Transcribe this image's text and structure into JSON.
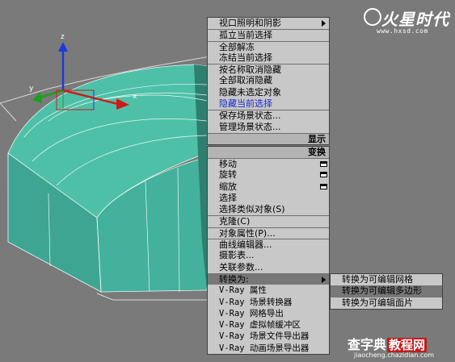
{
  "logo": {
    "main": "火星时代",
    "url": "www.hxsd.com"
  },
  "viewport": {
    "axis_labels": {
      "x": "x",
      "y": "y",
      "z": "z"
    }
  },
  "quad_menu_top": {
    "items": [
      {
        "label": "视口照明和阴影",
        "submenu": true
      },
      {
        "label": "孤立当前选择"
      },
      {
        "label": "全部解冻"
      },
      {
        "label": "冻结当前选择"
      },
      {
        "label": "按名称取消隐藏"
      },
      {
        "label": "全部取消隐藏"
      },
      {
        "label": "隐藏未选定对象"
      },
      {
        "label": "隐藏当前选择",
        "highlight": true
      },
      {
        "label": "保存场景状态..."
      },
      {
        "label": "管理场景状态..."
      }
    ],
    "quad_label": "显示"
  },
  "quad_menu_bottom": {
    "quad_label": "变换",
    "items": [
      {
        "label": "移动",
        "options_box": true
      },
      {
        "label": "旋转",
        "options_box": true
      },
      {
        "label": "缩放",
        "options_box": true
      },
      {
        "label": "选择"
      },
      {
        "label": "选择类似对象(S)"
      },
      {
        "label": "克隆(C)"
      },
      {
        "label": "对象属性(P)..."
      },
      {
        "label": "曲线编辑器..."
      },
      {
        "label": "摄影表..."
      },
      {
        "label": "关联参数..."
      },
      {
        "label": "转换为:",
        "submenu": true,
        "active": true
      },
      {
        "label": "V-Ray 属性"
      },
      {
        "label": "V-Ray 场景转换器"
      },
      {
        "label": "V-Ray 网格导出"
      },
      {
        "label": "V-Ray 虚拟帧缓冲区"
      },
      {
        "label": "V-Ray 场景文件导出器"
      },
      {
        "label": "V-Ray 动画场景导出器"
      }
    ]
  },
  "convert_submenu": {
    "items": [
      {
        "label": "转换为可编辑网格"
      },
      {
        "label": "转换为可编辑多边形",
        "active": true
      },
      {
        "label": "转换为可编辑面片"
      }
    ]
  },
  "watermark": {
    "main_a": "查字典",
    "main_b": "教程网",
    "url": "jiaocheng.chazidian.com"
  },
  "colors": {
    "mesh_face": "#4fc0a8",
    "mesh_side": "#2e7f70",
    "menu_bg": "#c8c8c8",
    "menu_active": "#787878",
    "viewport_bg": "#7a7a7a"
  }
}
